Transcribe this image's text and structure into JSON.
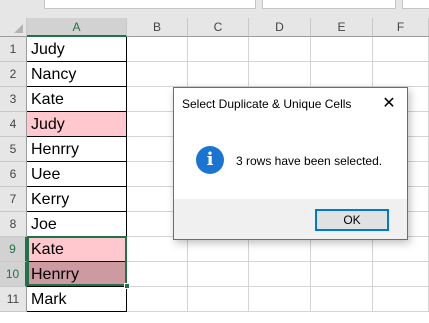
{
  "sheet": {
    "columns": [
      "A",
      "B",
      "C",
      "D",
      "E",
      "F"
    ],
    "selected_column": "A",
    "rows": [
      {
        "num": "1",
        "value": "Judy",
        "highlight": "none"
      },
      {
        "num": "2",
        "value": "Nancy",
        "highlight": "none"
      },
      {
        "num": "3",
        "value": "Kate",
        "highlight": "none"
      },
      {
        "num": "4",
        "value": "Judy",
        "highlight": "pink"
      },
      {
        "num": "5",
        "value": "Henrry",
        "highlight": "none"
      },
      {
        "num": "6",
        "value": "Uee",
        "highlight": "none"
      },
      {
        "num": "7",
        "value": "Kerry",
        "highlight": "none"
      },
      {
        "num": "8",
        "value": "Joe",
        "highlight": "none"
      },
      {
        "num": "9",
        "value": "Kate",
        "highlight": "pink"
      },
      {
        "num": "10",
        "value": "Henrry",
        "highlight": "dark"
      },
      {
        "num": "11",
        "value": "Mark",
        "highlight": "none"
      }
    ],
    "selected_rows": [
      "9",
      "10"
    ],
    "colors": {
      "pink": "#ffc7ce",
      "dark": "#cd9aa1",
      "selection": "#217346"
    }
  },
  "dialog": {
    "title": "Select Duplicate & Unique Cells",
    "close_icon": "close-icon",
    "info_icon": "info-icon",
    "info_glyph": "i",
    "message": "3 rows have been selected.",
    "ok_label": "OK",
    "border_color": "#1883d7"
  }
}
